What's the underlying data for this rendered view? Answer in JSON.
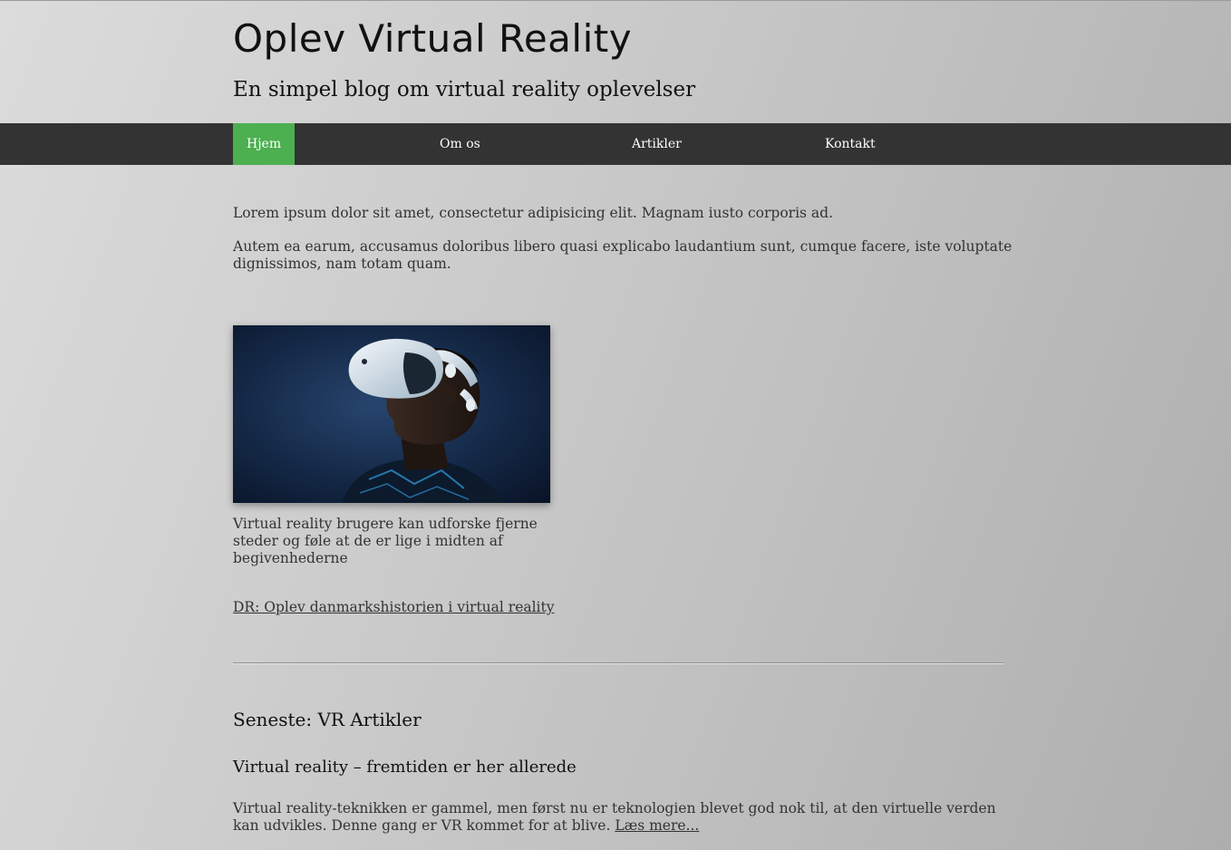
{
  "header": {
    "title": "Oplev Virtual Reality",
    "subtitle": "En simpel blog om virtual reality oplevelser"
  },
  "nav": {
    "items": [
      {
        "label": "Hjem",
        "active": true
      },
      {
        "label": "Om os",
        "active": false
      },
      {
        "label": "Artikler",
        "active": false
      },
      {
        "label": "Kontakt",
        "active": false
      }
    ],
    "active_color": "#4caf50",
    "background_color": "#333333"
  },
  "intro": {
    "paragraphs": [
      "Lorem ipsum dolor sit amet, consectetur adipisicing elit. Magnam iusto corporis ad.",
      "Autem ea earum, accusamus doloribus libero quasi explicabo laudantium sunt, cumque facere, iste voluptate dignissimos, nam totam quam."
    ]
  },
  "figure": {
    "image": "vr-headset-person-photo",
    "caption": "Virtual reality brugere kan udforske fjerne steder og føle at de er lige i midten af begivenhederne"
  },
  "external_link": {
    "label": "DR: Oplev danmarkshistorien i virtual reality"
  },
  "latest": {
    "heading": "Seneste: VR Artikler",
    "articles": [
      {
        "title": "Virtual reality – fremtiden er her allerede",
        "excerpt": "Virtual reality-teknikken er gammel, men først nu er teknologien blevet god nok til, at den virtuelle verden kan udvikles. Denne gang er VR kommet for at blive.",
        "read_more": "Læs mere..."
      }
    ]
  }
}
